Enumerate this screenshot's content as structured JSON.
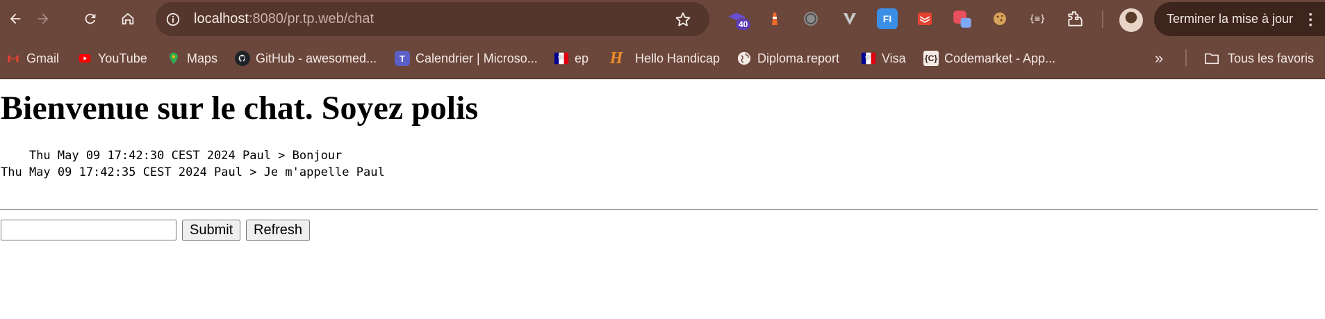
{
  "browser": {
    "url_host": "localhost",
    "url_rest": ":8080/pr.tp.web/chat",
    "extension_badge": "40",
    "extension_json_label": "{≡}",
    "finish_button_label": "Terminer la mise à jour",
    "nav_icons": [
      "back-icon",
      "forward-icon",
      "reload-icon",
      "home-icon"
    ]
  },
  "bookmarks": {
    "items": [
      {
        "label": "Gmail",
        "icon": "gmail-icon",
        "color": "#ea4335"
      },
      {
        "label": "YouTube",
        "icon": "youtube-icon",
        "color": "#ff0000"
      },
      {
        "label": "Maps",
        "icon": "maps-icon",
        "color": "#34a853"
      },
      {
        "label": "GitHub - awesomed...",
        "icon": "github-icon",
        "color": "#1f2328"
      },
      {
        "label": "Calendrier | Microso...",
        "icon": "teams-icon",
        "color": "#5b5fc7"
      },
      {
        "label": "ep",
        "icon": "marianne-icon",
        "color": "#000091"
      },
      {
        "label": "Hello Handicap",
        "icon": "hello-handicap-icon",
        "color": "#f28c28"
      },
      {
        "label": "Diploma.report",
        "icon": "globe-icon",
        "color": "#ffffff"
      },
      {
        "label": "Visa",
        "icon": "marianne-icon",
        "color": "#000091"
      },
      {
        "label": "Codemarket - App...",
        "icon": "codemarket-icon",
        "color": "#ffffff"
      }
    ],
    "all_bookmarks_label": "Tous les favoris"
  },
  "page": {
    "title": "Bienvenue sur le chat. Soyez polis",
    "log_text": "    Thu May 09 17:42:30 CEST 2024 Paul > Bonjour\nThu May 09 17:42:35 CEST 2024 Paul > Je m'appelle Paul",
    "message_input_value": "",
    "submit_label": "Submit",
    "refresh_label": "Refresh"
  }
}
